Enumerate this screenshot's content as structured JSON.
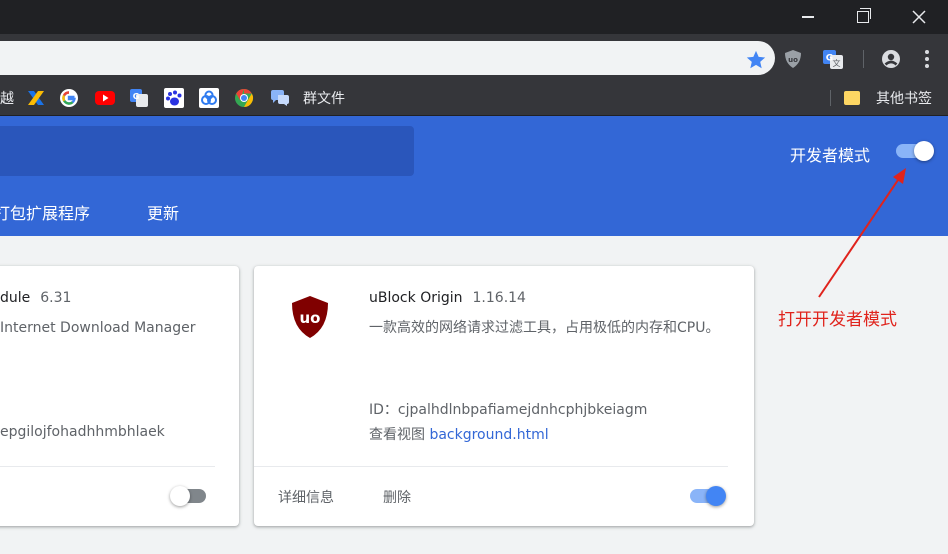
{
  "bookmarks": {
    "items": [
      {
        "icon": "partial-chinese-text-icon",
        "label": "越"
      },
      {
        "icon": "x-logo-icon",
        "label": ""
      },
      {
        "icon": "google-icon",
        "label": ""
      },
      {
        "icon": "youtube-icon",
        "label": ""
      },
      {
        "icon": "google-translate-icon",
        "label": ""
      },
      {
        "icon": "baidu-paw-icon",
        "label": ""
      },
      {
        "icon": "baidu-cloud-icon",
        "label": ""
      },
      {
        "icon": "chrome-logo-icon",
        "label": ""
      },
      {
        "icon": "chat-bubbles-icon",
        "label": "群文件"
      }
    ],
    "other_folder": "其他书签"
  },
  "header": {
    "developer_mode_label": "开发者模式",
    "developer_mode_on": true,
    "pack_extension_label": "打包扩展程序",
    "update_label": "更新"
  },
  "extensions": [
    {
      "name": "dule",
      "version": "6.31",
      "description": "Internet Download Manager",
      "id_text": "epgilojfohadhhmbhlaek",
      "enabled": false
    },
    {
      "name": "uBlock Origin",
      "version": "1.16.14",
      "description": "一款高效的网络请求过滤工具，占用极低的内存和CPU。",
      "id_label": "ID：",
      "id_value": "cjpalhdlnbpafiamejdnhcphjbkeiagm",
      "inspect_label": "查看视图",
      "inspect_link": "background.html",
      "details_button": "详细信息",
      "remove_button": "删除",
      "enabled": true
    }
  ],
  "annotation": {
    "text": "打开开发者模式",
    "color": "#e0231c"
  },
  "colors": {
    "accent": "#3367d6",
    "toggle_on": "#4285f4"
  }
}
